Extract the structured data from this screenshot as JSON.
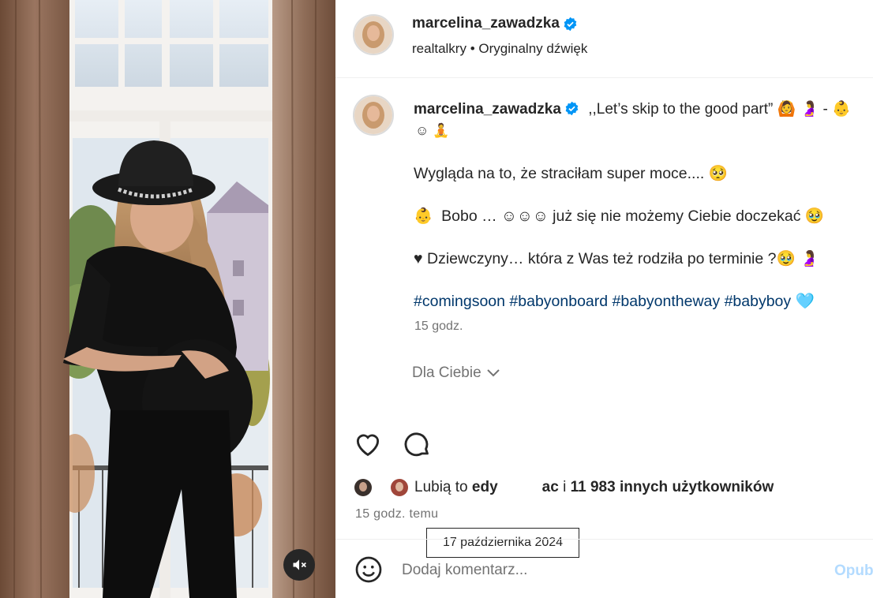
{
  "colors": {
    "link": "#00376b",
    "muted": "#737373",
    "verified": "#0095f6",
    "post_disabled": "#b3dbff"
  },
  "media": {
    "mute_icon": "speaker-muted-icon"
  },
  "header": {
    "username": "marcelina_zawadzka",
    "audio_author": "realtalkry",
    "separator": "•",
    "audio_title": "Oryginalny dźwięk"
  },
  "caption": {
    "username": "marcelina_zawadzka",
    "line1_text": ",,Let’s skip to the good part”",
    "line1_emojis": "🙆 🤰 - 👶",
    "line1_cont": "☺ 🧘",
    "p1_text": "Wygląda na to, że straciłam super moce....",
    "p1_emoji": "🥺",
    "p2_emoji": "👶",
    "p2_text": "Bobo … ☺☺☺ już się nie możemy Ciebie doczekać",
    "p2_emoji_end": "🥹",
    "p3_text": "♥ Dziewczyny… która z Was też rodziła po terminie ?",
    "p3_emojis": "🥹 🤰",
    "hashtags": [
      "#comingsoon",
      "#babyonboard",
      "#babyontheway",
      "#babyboy"
    ],
    "hashtags_emoji": "🩵",
    "time": "15 godz."
  },
  "for_you": {
    "label": "Dla Ciebie"
  },
  "actions": {
    "like_icon": "heart-icon",
    "comment_icon": "comment-icon"
  },
  "likes": {
    "prefix": "Lubią to",
    "user_part1": "edy",
    "user_part2": "ac",
    "suffix_i": "i",
    "others": "11 983 innych użytkowników"
  },
  "time_ago": "15 godz. temu",
  "tooltip": "17 października 2024",
  "comment": {
    "placeholder": "Dodaj komentarz...",
    "post_label": "Opublikuj",
    "emoji_icon": "smiley-icon"
  }
}
